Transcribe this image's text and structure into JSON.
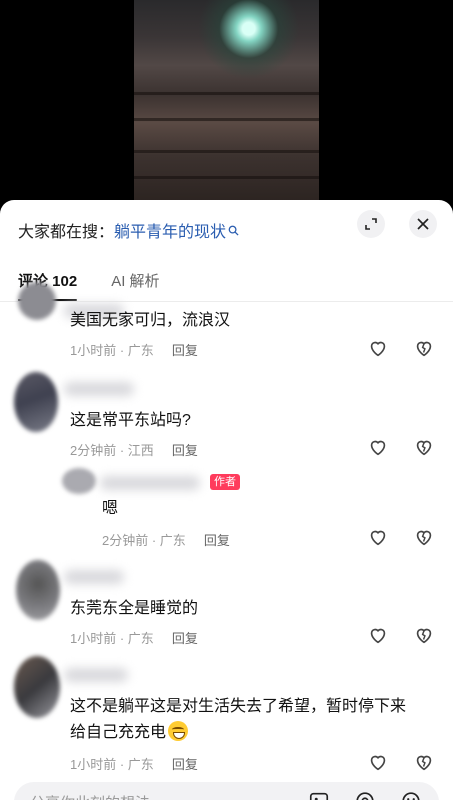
{
  "search": {
    "prefix": "大家都在搜：",
    "term": "躺平青年的现状"
  },
  "tabs": [
    {
      "label": "评论 102",
      "active": true
    },
    {
      "label": "AI 解析",
      "active": false
    }
  ],
  "comments": [
    {
      "text": "美国无家可归，流浪汉",
      "time": "1小时前",
      "location": "广东",
      "reply": "回复"
    },
    {
      "text": "这是常平东站吗?",
      "time": "2分钟前",
      "location": "江西",
      "reply": "回复"
    },
    {
      "text": "嗯",
      "time": "2分钟前",
      "location": "广东",
      "reply": "回复",
      "badge": "作者"
    },
    {
      "text": "东莞东全是睡觉的",
      "time": "1小时前",
      "location": "广东",
      "reply": "回复"
    },
    {
      "text_line1": "这不是躺平这是对生活失去了希望，暂时停下来",
      "text_line2": "给自己充充电",
      "time": "1小时前",
      "location": "广东",
      "reply": "回复"
    }
  ],
  "input": {
    "placeholder": "分享你此刻的想法"
  },
  "colors": {
    "accent": "#2a5db0",
    "badge": "#ff3b5c",
    "sheet": "#ffffff",
    "backdrop": "#000000"
  },
  "icons": [
    "search-icon",
    "expand-icon",
    "close-icon",
    "heart-icon",
    "broken-heart-icon",
    "emoji-icon",
    "at-icon",
    "image-icon"
  ]
}
